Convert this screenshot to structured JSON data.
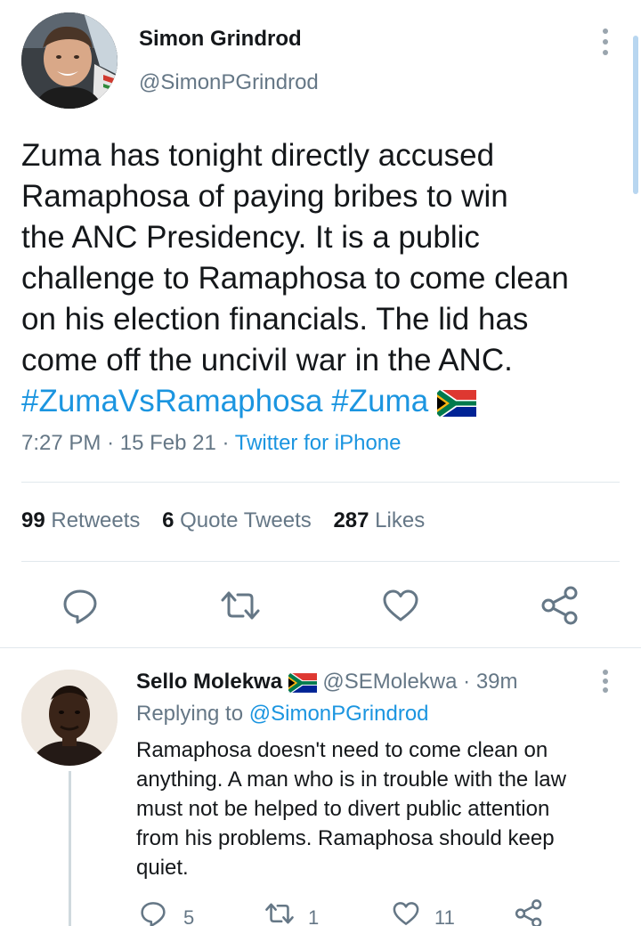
{
  "tweet": {
    "author_name": "Simon Grindrod",
    "author_handle": "@SimonPGrindrod",
    "text_lines": [
      "Zuma has tonight directly accused",
      "Ramaphosa of paying bribes to win",
      "the ANC Presidency. It is a public",
      "challenge to Ramaphosa to come clean",
      "on his election financials. The lid has",
      "come off the uncivil war in the ANC."
    ],
    "hashtags": [
      "#ZumaVsRamaphosa",
      "#Zuma"
    ],
    "time": "7:27 PM",
    "date": "15 Feb 21",
    "separator": "·",
    "source": "Twitter for iPhone",
    "stats": {
      "retweets_count": "99",
      "retweets_label": "Retweets",
      "quotes_count": "6",
      "quotes_label": "Quote Tweets",
      "likes_count": "287",
      "likes_label": "Likes"
    },
    "icons": [
      "reply-icon",
      "retweet-icon",
      "like-icon",
      "share-icon"
    ]
  },
  "reply": {
    "author_name": "Sello Molekwa",
    "author_handle": "@SEMolekwa",
    "separator": "·",
    "age": "39m",
    "replying_label": "Replying to",
    "replying_to": "@SimonPGrindrod",
    "text_lines": [
      "Ramaphosa doesn't need to come clean on",
      "anything. A man who is in trouble with the law",
      "must not be helped to divert public attention",
      "from his problems. Ramaphosa should keep",
      "quiet."
    ],
    "reply_count": "5",
    "retweet_count": "1",
    "like_count": "11"
  },
  "colors": {
    "link": "#1b95e0",
    "secondary_text": "#657786",
    "primary_text": "#14171a",
    "divider": "#e1e8ed"
  }
}
